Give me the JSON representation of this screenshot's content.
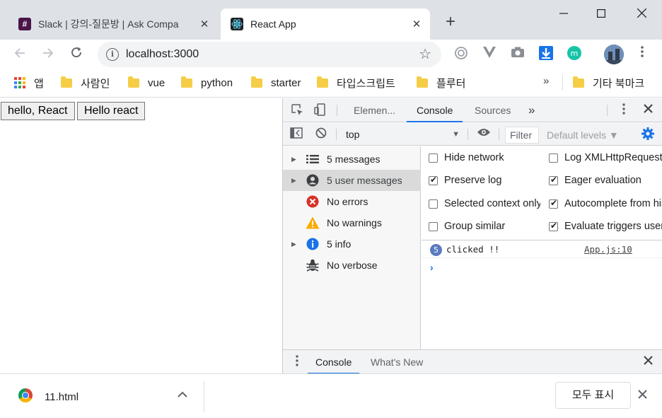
{
  "tabs": [
    {
      "title": "Slack | 강의-질문방 | Ask Compa",
      "active": false
    },
    {
      "title": "React App",
      "active": true
    }
  ],
  "toolbar": {
    "url": "localhost:3000"
  },
  "bookmarks": {
    "apps_label": "앱",
    "items": [
      "사람인",
      "vue",
      "python",
      "starter",
      "타입스크립트",
      "플루터"
    ],
    "more": "»",
    "other_bookmarks": "기타 북마크"
  },
  "page": {
    "buttons": [
      "hello, React",
      "Hello react"
    ]
  },
  "devtools": {
    "tabs": {
      "elements": "Elemen...",
      "console": "Console",
      "sources": "Sources",
      "more": "»"
    },
    "console_toolbar": {
      "context": "top",
      "filter_placeholder": "Filter",
      "levels": "Default levels ▼"
    },
    "sidebar": [
      {
        "label": "5 messages",
        "icon": "list-icon",
        "expandable": true
      },
      {
        "label": "5 user messages",
        "icon": "user-icon",
        "expandable": true,
        "selected": true
      },
      {
        "label": "No errors",
        "icon": "error-icon",
        "expandable": false
      },
      {
        "label": "No warnings",
        "icon": "warning-icon",
        "expandable": false
      },
      {
        "label": "5 info",
        "icon": "info-icon",
        "expandable": true
      },
      {
        "label": "No verbose",
        "icon": "bug-icon",
        "expandable": false
      }
    ],
    "settings": {
      "hide_network": {
        "label": "Hide network",
        "checked": false
      },
      "preserve_log": {
        "label": "Preserve log",
        "checked": true
      },
      "selected_context": {
        "label": "Selected context only",
        "checked": false
      },
      "group_similar": {
        "label": "Group similar",
        "checked": false
      },
      "log_xhr": {
        "label": "Log XMLHttpRequests",
        "checked": false
      },
      "eager_eval": {
        "label": "Eager evaluation",
        "checked": true
      },
      "autocomplete": {
        "label": "Autocomplete from history",
        "checked": true
      },
      "eval_triggers": {
        "label": "Evaluate triggers user activation",
        "checked": true
      }
    },
    "log": {
      "count": "5",
      "message": "clicked !!",
      "source": "App.js:10",
      "prompt": "›"
    },
    "drawer": {
      "console": "Console",
      "whats_new": "What's New"
    }
  },
  "download_shelf": {
    "filename": "11.html",
    "show_all": "모두 표시"
  },
  "colors": {
    "accent": "#1a73e8",
    "tabstrip": "#dee1e6",
    "error": "#d93025",
    "warning": "#f9ab00",
    "info": "#1a73e8"
  }
}
